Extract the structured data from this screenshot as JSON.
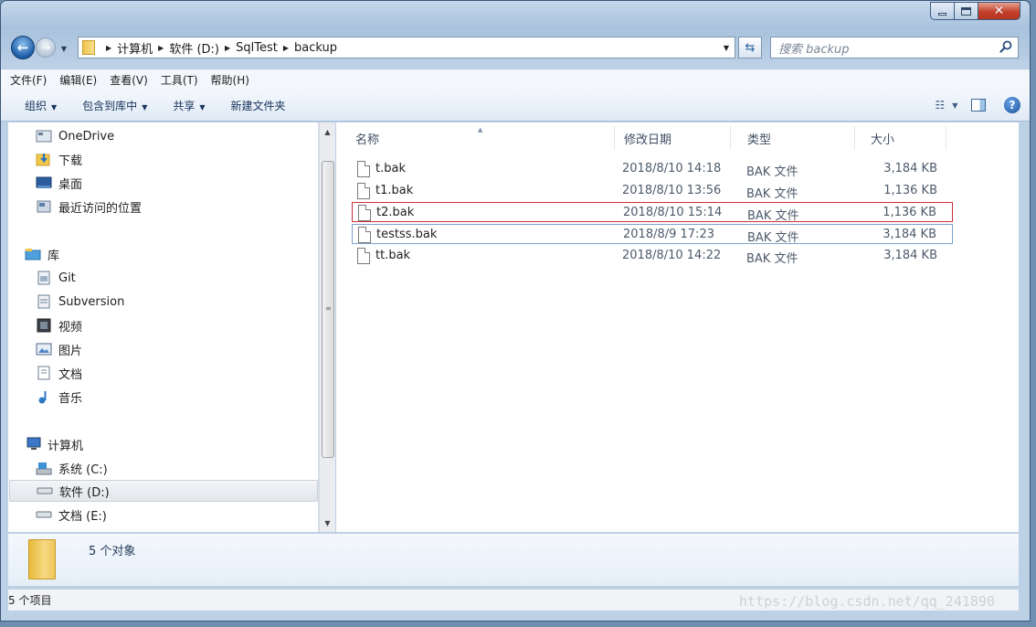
{
  "address": {
    "crumbs": [
      "计算机",
      "软件 (D:)",
      "SqlTest",
      "backup"
    ]
  },
  "search": {
    "placeholder": "搜索 backup"
  },
  "menu": [
    "文件(F)",
    "编辑(E)",
    "查看(V)",
    "工具(T)",
    "帮助(H)"
  ],
  "commands": {
    "organize": "组织",
    "include_library": "包含到库中",
    "share": "共享",
    "new_folder": "新建文件夹"
  },
  "nav": {
    "favorites": [
      "OneDrive",
      "下载",
      "桌面",
      "最近访问的位置"
    ],
    "library_title": "库",
    "libraries": [
      "Git",
      "Subversion",
      "视频",
      "图片",
      "文档",
      "音乐"
    ],
    "computer_title": "计算机",
    "drives": [
      "系统 (C:)",
      "软件 (D:)",
      "文档 (E:)"
    ]
  },
  "columns": {
    "name": "名称",
    "date": "修改日期",
    "type": "类型",
    "size": "大小"
  },
  "files": [
    {
      "name": "t.bak",
      "date": "2018/8/10 14:18",
      "type": "BAK 文件",
      "size": "3,184 KB"
    },
    {
      "name": "t1.bak",
      "date": "2018/8/10 13:56",
      "type": "BAK 文件",
      "size": "1,136 KB"
    },
    {
      "name": "t2.bak",
      "date": "2018/8/10 15:14",
      "type": "BAK 文件",
      "size": "1,136 KB"
    },
    {
      "name": "testss.bak",
      "date": "2018/8/9 17:23",
      "type": "BAK 文件",
      "size": "3,184 KB"
    },
    {
      "name": "tt.bak",
      "date": "2018/8/10 14:22",
      "type": "BAK 文件",
      "size": "3,184 KB"
    }
  ],
  "details": {
    "count_text": "5 个对象"
  },
  "status": {
    "text": "5 个项目"
  },
  "watermark": "https://blog.csdn.net/qq_241890"
}
